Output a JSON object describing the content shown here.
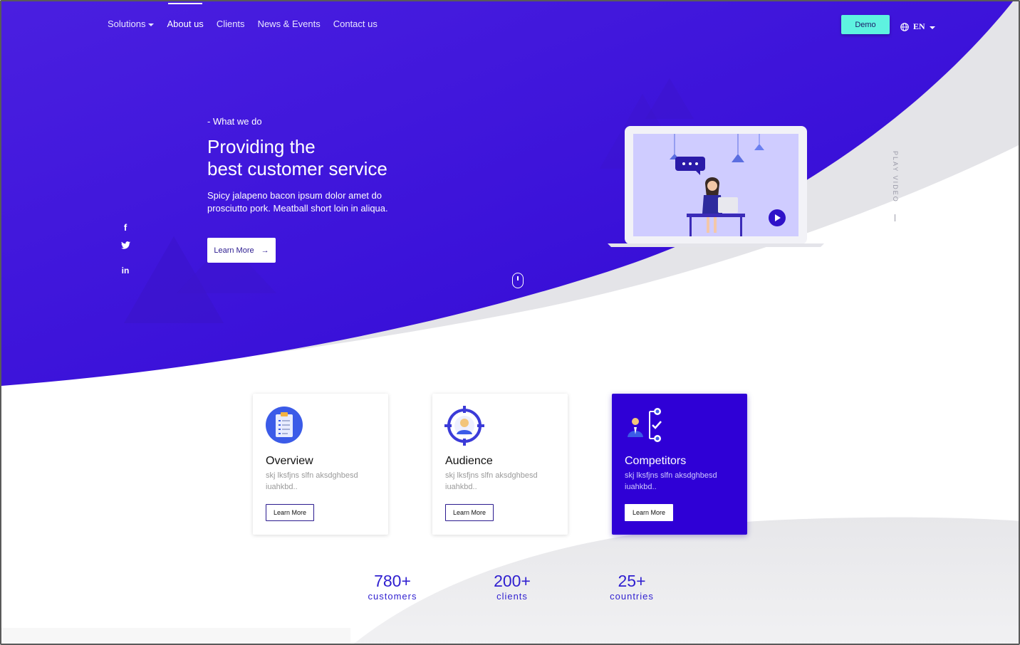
{
  "nav": {
    "items": [
      {
        "label": "Solutions",
        "dropdown": true
      },
      {
        "label": "About us",
        "active": true
      },
      {
        "label": "Clients"
      },
      {
        "label": "News & Events"
      },
      {
        "label": "Contact us"
      }
    ],
    "demo_label": "Demo",
    "language": "EN"
  },
  "hero": {
    "eyebrow": "- What we do",
    "title_line1": "Providing the",
    "title_line2": "best customer service",
    "description": "Spicy jalapeno bacon ipsum dolor amet do prosciutto pork. Meatball short loin in aliqua.",
    "button_label": "Learn More",
    "button_arrow": "→",
    "play_video_label": "PLAY VIDEO"
  },
  "social": {
    "facebook": "f",
    "twitter": "twitter-icon",
    "linkedin": "in"
  },
  "cards": [
    {
      "title": "Overview",
      "text": "skj lksfjns slfn aksdghbesd iuahkbd..",
      "button": "Learn More",
      "icon": "clipboard-icon"
    },
    {
      "title": "Audience",
      "text": "skj lksfjns slfn aksdghbesd iuahkbd..",
      "button": "Learn More",
      "icon": "target-person-icon"
    },
    {
      "title": "Competitors",
      "text": "skj lksfjns slfn aksdghbesd iuahkbd..",
      "button": "Learn More",
      "icon": "person-checklist-icon"
    }
  ],
  "stats": [
    {
      "value": "780+",
      "label": "customers"
    },
    {
      "value": "200+",
      "label": "clients"
    },
    {
      "value": "25+",
      "label": "countries"
    }
  ],
  "colors": {
    "primary": "#3a10d8",
    "accent": "#5ef2e0",
    "stat_text": "#2f1fd0",
    "card_active": "#2f00d6"
  }
}
